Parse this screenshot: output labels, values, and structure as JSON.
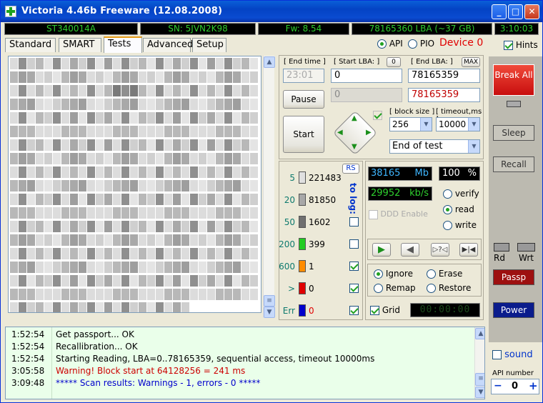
{
  "window": {
    "title": "Victoria 4.46b Freeware (12.08.2008)",
    "min": "_",
    "max": "□",
    "close": "✕"
  },
  "infobar": {
    "model": "ST340014A",
    "serial": "SN: 5JVN2K98",
    "firmware": "Fw: 8.54",
    "lba": "78165360 LBA (~37 GB)",
    "clock": "3:10:03"
  },
  "tabs": [
    "Standard",
    "SMART",
    "Tests",
    "Advanced",
    "Setup"
  ],
  "active_tab": "Tests",
  "api": {
    "api_label": "API",
    "pio_label": "PIO",
    "device_label": "Device 0",
    "hints_label": "Hints"
  },
  "params": {
    "end_time_label": "[ End time ]",
    "end_time_value": "23:01",
    "start_lba_label": "[ Start LBA: ]",
    "start_lba_reset": "0",
    "start_lba_value": "0",
    "end_lba_label": "[ End LBA: ]",
    "end_lba_max": "MAX",
    "end_lba_value": "78165359",
    "current_lba": "0",
    "current_end": "78165359",
    "pause_label": "Pause",
    "start_label": "Start",
    "block_size_label": "[ block size ]",
    "block_size_value": "256",
    "timeout_label": "[ timeout,ms ]",
    "timeout_value": "10000",
    "end_action_value": "End of test"
  },
  "stats": {
    "rs_label": "RS",
    "to_log_label": "to log:",
    "rows": [
      {
        "threshold": "5",
        "count": "221483",
        "color": "#e0e0e0",
        "log": false
      },
      {
        "threshold": "20",
        "count": "81850",
        "color": "#a8a8a8",
        "log": false
      },
      {
        "threshold": "50",
        "count": "1602",
        "color": "#707070",
        "log": false
      },
      {
        "threshold": "200",
        "count": "399",
        "color": "#22cc22",
        "log": false
      },
      {
        "threshold": "600",
        "count": "1",
        "color": "#ff8c00",
        "log": true
      },
      {
        "threshold": ">",
        "count": "0",
        "color": "#e00000",
        "log": true
      },
      {
        "threshold": "Err",
        "count": "0",
        "color": "#0000cc",
        "log": true
      }
    ]
  },
  "readout": {
    "mb_value": "38165",
    "mb_unit": "Mb",
    "percent_value": "100",
    "percent_unit": "%",
    "speed_value": "29952",
    "speed_unit": "kb/s",
    "ddd_label": "DDD Enable",
    "mode_verify": "verify",
    "mode_read": "read",
    "mode_write": "write",
    "action_ignore": "Ignore",
    "action_erase": "Erase",
    "action_remap": "Remap",
    "action_restore": "Restore",
    "grid_label": "Grid",
    "timer": "00:00:00"
  },
  "right": {
    "break_all": "Break All",
    "sleep": "Sleep",
    "recall": "Recall",
    "rd": "Rd",
    "wrt": "Wrt",
    "passp": "Passp",
    "power": "Power",
    "sound": "sound",
    "api_number_label": "API number",
    "api_number_value": "0",
    "minus": "−",
    "plus": "+"
  },
  "log": [
    {
      "time": "1:52:54",
      "message": "Get passport... OK",
      "color": "#000000"
    },
    {
      "time": "1:52:54",
      "message": "Recallibration... OK",
      "color": "#000000"
    },
    {
      "time": "1:52:54",
      "message": "Starting Reading, LBA=0..78165359, sequential access, timeout 10000ms",
      "color": "#000000"
    },
    {
      "time": "3:05:58",
      "message": "Warning! Block start at 64128256 = 241 ms",
      "color": "#cc0000"
    },
    {
      "time": "3:09:48",
      "message": "***** Scan results: Warnings - 1, errors - 0 *****",
      "color": "#0000cc"
    }
  ]
}
